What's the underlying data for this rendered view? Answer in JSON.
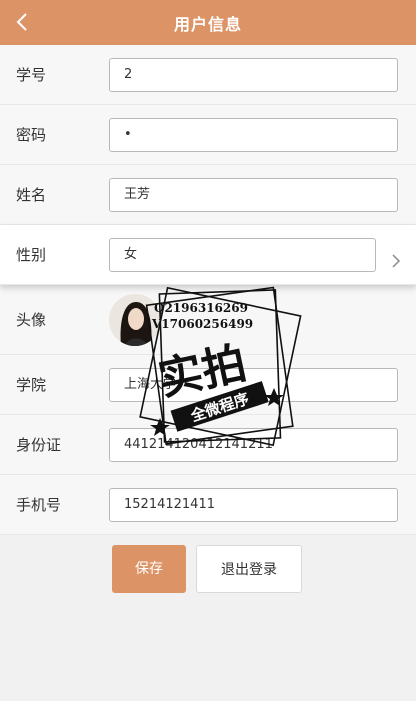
{
  "header": {
    "title": "用户信息",
    "back_icon": "chevron-left-icon"
  },
  "form": {
    "student_id": {
      "label": "学号",
      "value": "2"
    },
    "password": {
      "label": "密码",
      "value": "•"
    },
    "name": {
      "label": "姓名",
      "value": "王芳"
    },
    "gender": {
      "label": "性别",
      "value": "女"
    },
    "avatar": {
      "label": "头像"
    },
    "college": {
      "label": "学院",
      "value": "上海大学"
    },
    "id_card": {
      "label": "身份证",
      "value": "441214120412141211"
    },
    "phone": {
      "label": "手机号",
      "value": "15214121411"
    }
  },
  "actions": {
    "save_label": "保存",
    "logout_label": "退出登录"
  },
  "watermark": {
    "qq": "Q2196316269",
    "wechat": "V17060256499",
    "stamp_main": "实拍",
    "stamp_sub": "全微程序"
  },
  "colors": {
    "accent": "#dc9467",
    "background": "#f1f1f1"
  }
}
